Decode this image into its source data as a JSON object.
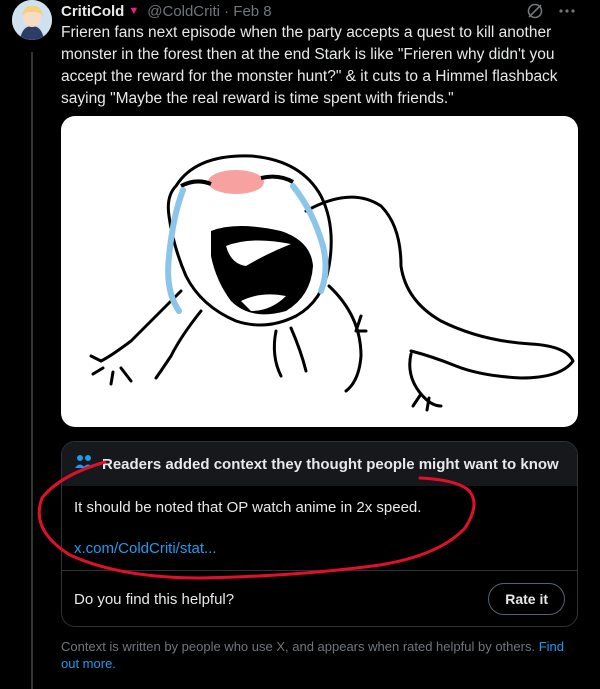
{
  "post": {
    "display_name": "CritiCold",
    "handle_and_time": "@ColdCriti · Feb 8",
    "text": "Frieren fans next episode when the party accepts a quest to kill another monster in the forest then at the end Stark is like \"Frieren why didn't you accept the reward for the monster hunt?\" & it cuts to a Himmel flashback saying \"Maybe the real reward is time spent with friends.\""
  },
  "community_note": {
    "header": "Readers added context they thought people might want to know",
    "text": "It should be noted that OP watch anime in 2x speed.",
    "link": "x.com/ColdCriti/stat...",
    "helpful_question": "Do you find this helpful?",
    "rate_button": "Rate it"
  },
  "disclaimer": {
    "text": "Context is written by people who use X, and appears when rated helpful by others.",
    "learn_more": "Find out more."
  },
  "colors": {
    "background": "#000000",
    "accent_link": "#1d9bf0",
    "annotation_red": "#e0102a"
  },
  "icons": [
    "grok-icon",
    "more-icon",
    "people-icon"
  ]
}
